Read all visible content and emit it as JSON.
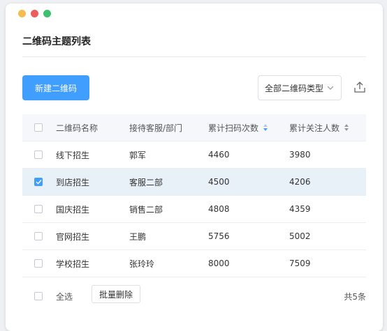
{
  "page": {
    "title": "二维码主题列表"
  },
  "toolbar": {
    "new_button_label": "新建二维码",
    "type_select_value": "全部二维码类型"
  },
  "table": {
    "headers": {
      "name": "二维码名称",
      "dept": "接待客服/部门",
      "scan": "累计扫码次数",
      "follow": "累计关注人数"
    },
    "rows": [
      {
        "name": "线下招生",
        "dept": "郭军",
        "scan": "4460",
        "follow": "3980",
        "checked": false
      },
      {
        "name": "到店招生",
        "dept": "客服二部",
        "scan": "4500",
        "follow": "4206",
        "checked": true
      },
      {
        "name": "国庆招生",
        "dept": "销售二部",
        "scan": "4808",
        "follow": "4359",
        "checked": false
      },
      {
        "name": "官网招生",
        "dept": "王鹏",
        "scan": "5756",
        "follow": "5002",
        "checked": false
      },
      {
        "name": "学校招生",
        "dept": "张玲玲",
        "scan": "8000",
        "follow": "7509",
        "checked": false
      }
    ]
  },
  "footer": {
    "select_all_label": "全选",
    "batch_delete_label": "批量删除",
    "total_label": "共5条"
  },
  "colors": {
    "accent": "#409eff",
    "selected_row": "#e8f0f8",
    "header_bg": "#f5f7fa"
  },
  "icons": {
    "window_controls": [
      "yellow-dot",
      "red-dot",
      "green-dot"
    ],
    "select_arrow": "chevron-down-icon",
    "export": "upload-icon",
    "sort": "sort-icon"
  }
}
